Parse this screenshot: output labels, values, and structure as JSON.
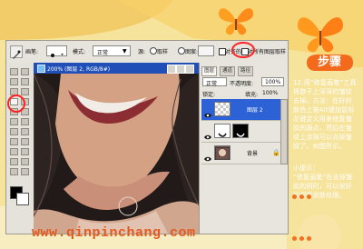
{
  "step_badge": "步骤",
  "website": "www.qinpinchang.com",
  "options_bar": {
    "brush_label": "画笔:",
    "mode_label": "模式:",
    "mode_value": "正常",
    "source_label": "源:",
    "source_sample": "取样",
    "source_pattern": "图案:",
    "aligned_label": "对齐的",
    "all_layers_label": "对所有图层取样"
  },
  "document": {
    "title": "200% (图层 2, RGB/8#)"
  },
  "layers_panel": {
    "tabs": [
      "图层",
      "通道",
      "路径"
    ],
    "blend_mode": "正常",
    "opacity_label": "不透明度:",
    "opacity_value": "100%",
    "lock_label": "锁定:",
    "fill_label": "填充:",
    "fill_value": "100%",
    "layers": [
      "图层 2",
      "",
      "背景"
    ]
  },
  "instructions": {
    "step_text": "12.用“修复画笔”工具将脖子上深深的皱纹去掉。方法：在好的肤色上按Alt键加鼠标左键定义用来修复皱纹的源点，然后在皱纹上涂抹可以去掉皱纹了，如图所示。",
    "tip_label": "小提示：",
    "tip_text": "“修复画笔”在去掉皱纹的同时，可以很好的保留皮肤纹理。"
  },
  "colors": {
    "page_background": "#f6e39c",
    "accent_orange": "#f46f1f",
    "dark_brown": "#2b2121",
    "titlebar_blue": "#1f4fb7",
    "layer_selected_blue": "#2d62d6"
  }
}
